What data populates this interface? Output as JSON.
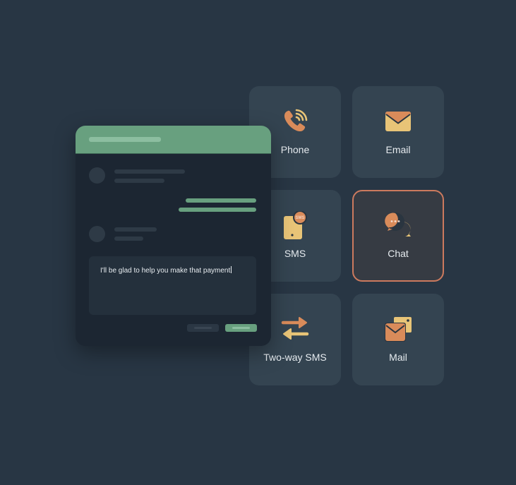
{
  "colors": {
    "background": "#283644",
    "card": "#344451",
    "selected_border": "#cc7a5e",
    "accent_green": "#68a07f",
    "icon_orange": "#d98b5a",
    "icon_yellow": "#e8c477"
  },
  "channels": [
    {
      "label": "Phone",
      "icon": "phone-icon",
      "selected": false
    },
    {
      "label": "Email",
      "icon": "envelope-icon",
      "selected": false
    },
    {
      "label": "SMS",
      "icon": "sms-phone-icon",
      "selected": false
    },
    {
      "label": "Chat",
      "icon": "chat-bubbles-icon",
      "selected": true
    },
    {
      "label": "Two-way SMS",
      "icon": "two-way-arrows-icon",
      "selected": false
    },
    {
      "label": "Mail",
      "icon": "mail-icon",
      "selected": false
    }
  ],
  "sms_badge": "SMS",
  "chat_window": {
    "composer_text": "I'll be glad to help you make that payment"
  }
}
